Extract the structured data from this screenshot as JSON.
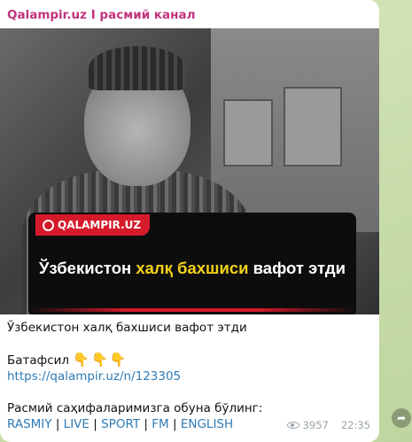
{
  "channel": {
    "name": "Qalampir.uz I расмий канал"
  },
  "photo": {
    "logo_text": "QALAMPIR.UZ",
    "headline_pre": "Ўзбекистон ",
    "headline_highlight": "халқ бахшиси",
    "headline_post": " вафот этди",
    "highlight_color": "#f4d21a",
    "brand_color": "#d51a2a"
  },
  "message": {
    "title": "Ўзбекистон халқ бахшиси вафот этди",
    "more_label": "Батафсил",
    "emoji": "👇👇👇",
    "link": "https://qalampir.uz/n/123305",
    "subscribe_label": "Расмий саҳифаларимизга обуна бўлинг:",
    "social_links": [
      "RASMIY",
      "LIVE",
      "SPORT",
      "FM",
      "ENGLISH"
    ],
    "separator": "|"
  },
  "meta": {
    "views": "3957",
    "time": "22:35"
  },
  "icons": {
    "views": "eye-icon",
    "share": "share-icon"
  }
}
